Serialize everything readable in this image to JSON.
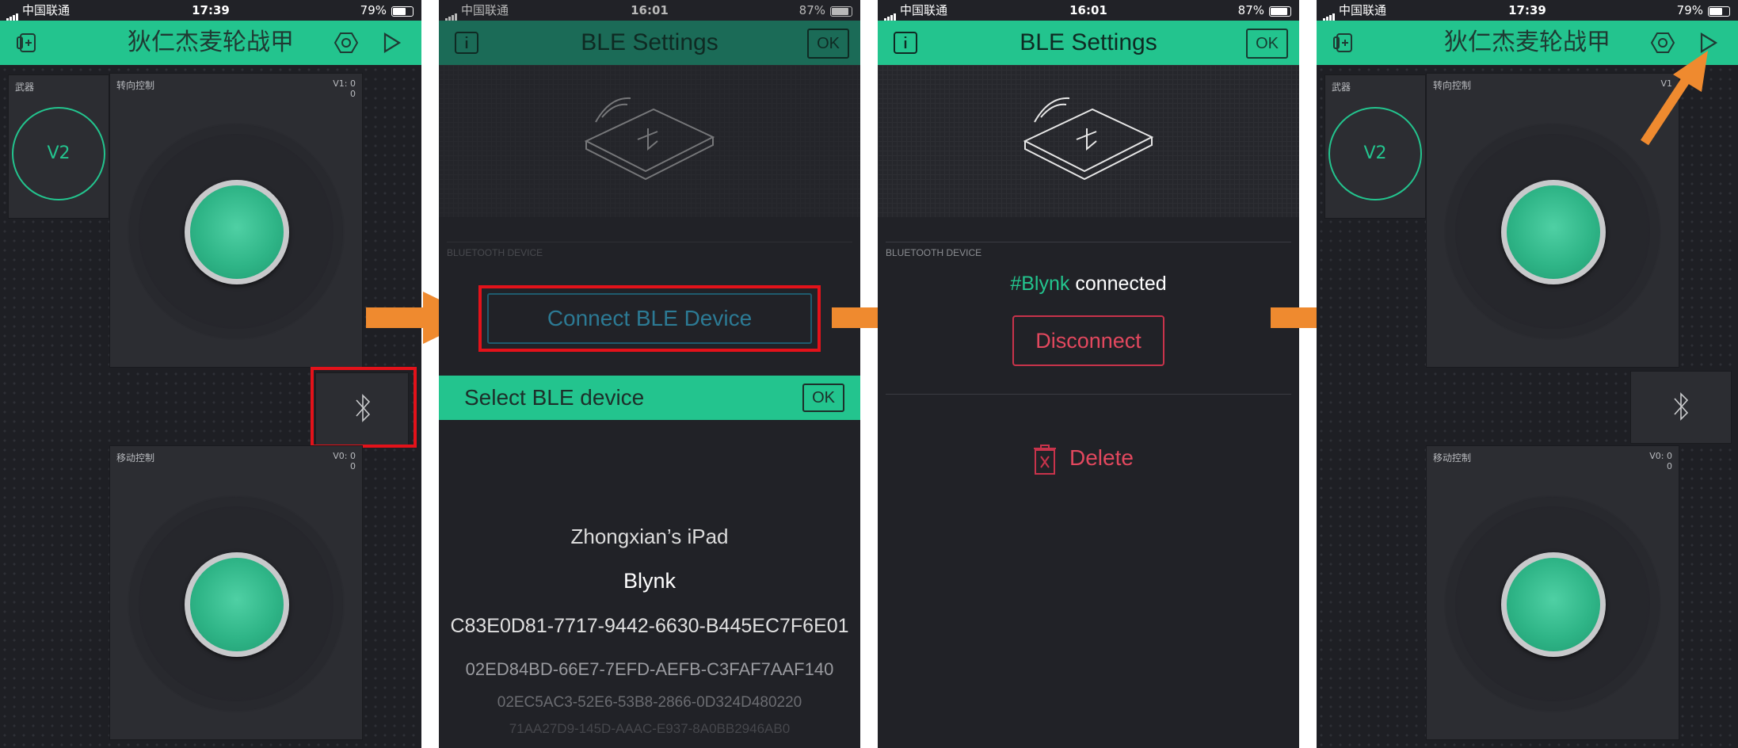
{
  "colors": {
    "accent": "#23c48e",
    "background": "#212227",
    "danger": "#e2485e",
    "highlight": "#e3121a",
    "arrow": "#ef8a2f"
  },
  "phone1": {
    "status": {
      "carrier": "中国联通",
      "time": "17:39",
      "battery": "79%"
    },
    "title": "狄仁杰麦轮战甲",
    "weapon_label": "武器",
    "v2_label": "V2",
    "joy1": {
      "label": "转向控制",
      "value_line1": "V1: 0",
      "value_line2": "0"
    },
    "joy2": {
      "label": "移动控制",
      "value_line1": "V0: 0",
      "value_line2": "0"
    }
  },
  "phone2": {
    "status": {
      "carrier": "中国联通",
      "time": "16:01",
      "battery": "87%"
    },
    "title": "BLE Settings",
    "ok_label": "OK",
    "section_label": "BLUETOOTH DEVICE",
    "connect_label": "Connect BLE Device",
    "select_title": "Select BLE device",
    "select_ok": "OK",
    "devices": [
      "Zhongxian’s iPad",
      "Blynk",
      "C83E0D81-7717-9442-6630-B445EC7F6E01",
      "02ED84BD-66E7-7EFD-AEFB-C3FAF7AAF140",
      "02EC5AC3-52E6-53B8-2866-0D324D480220",
      "71AA27D9-145D-AAAC-E937-8A0BB2946AB0"
    ]
  },
  "phone3": {
    "status": {
      "carrier": "中国联通",
      "time": "16:01",
      "battery": "87%"
    },
    "title": "BLE Settings",
    "ok_label": "OK",
    "section_label": "BLUETOOTH DEVICE",
    "device_name": "#Blynk",
    "connected_text": "connected",
    "disconnect_label": "Disconnect",
    "delete_label": "Delete"
  },
  "phone4": {
    "status": {
      "carrier": "中国联通",
      "time": "17:39",
      "battery": "79%"
    },
    "title": "狄仁杰麦轮战甲",
    "weapon_label": "武器",
    "v2_label": "V2",
    "joy1": {
      "label": "转向控制",
      "value_line1": "V1"
    },
    "joy2": {
      "label": "移动控制",
      "value_line1": "V0: 0",
      "value_line2": "0"
    }
  }
}
